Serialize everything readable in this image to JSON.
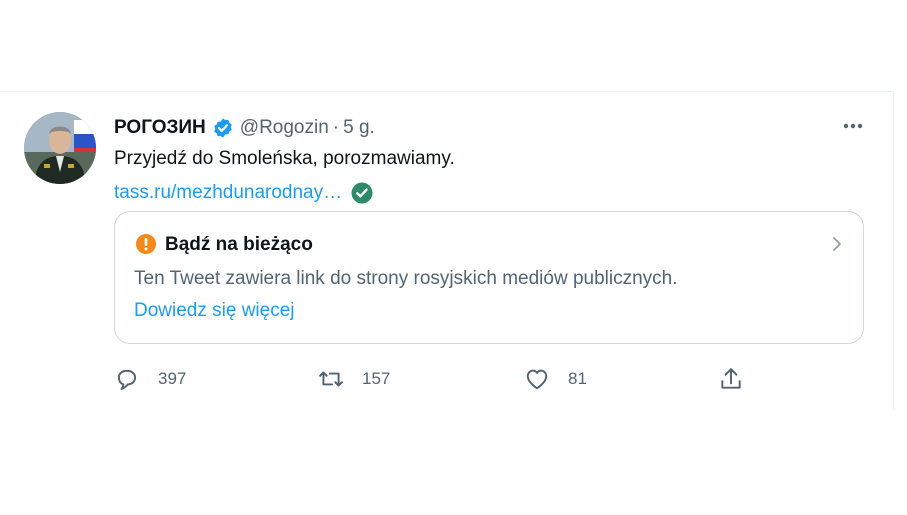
{
  "tweet": {
    "display_name": "РОГОЗИН",
    "handle": "@Rogozin",
    "separator": "·",
    "time": "5 g.",
    "text": "Przyjedź do Smoleńska, porozmawiamy.",
    "link": "tass.ru/mezhdunarodnay…"
  },
  "notice": {
    "title": "Bądź na bieżąco",
    "description": "Ten Tweet zawiera link do strony rosyjskich mediów publicznych.",
    "learn_more": "Dowiedz się więcej"
  },
  "actions": {
    "replies": "397",
    "retweets": "157",
    "likes": "81"
  },
  "icons": {
    "verified": "verified-badge-icon",
    "more": "more-icon",
    "safe_link": "check-circle-icon",
    "notice": "warning-icon",
    "chevron": "chevron-right-icon",
    "reply": "reply-icon",
    "retweet": "retweet-icon",
    "like": "heart-icon",
    "share": "share-icon"
  },
  "colors": {
    "accent": "#1d9bf0",
    "secondary_text": "#536471",
    "warning": "#f4881b",
    "safe": "#2e8a6b",
    "border": "#cfd9de"
  }
}
